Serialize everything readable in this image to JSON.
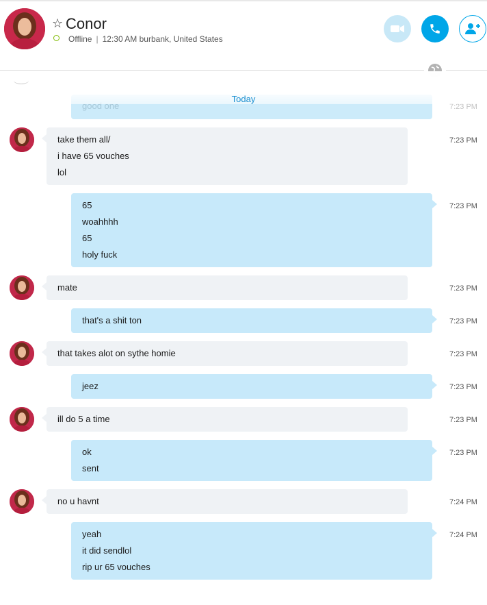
{
  "contact": {
    "name": "Conor",
    "status": "Offline",
    "local_info": "12:30 AM burbank, United States"
  },
  "header_buttons": {
    "video_icon": "video-camera-icon",
    "call_icon": "phone-icon",
    "add_icon": "add-people-icon"
  },
  "colors": {
    "accent": "#00a6e8",
    "outgoing_bubble": "#c7e9fa",
    "incoming_bubble": "#eff2f5",
    "date_label": "#1b8fd0",
    "offline_ring": "#7fba00"
  },
  "date_separator": "Today",
  "previous_message": {
    "text": "good one",
    "time": "7:23 PM"
  },
  "messages": [
    {
      "dir": "in",
      "lines": [
        "take them all/",
        "i have 65 vouches",
        "lol"
      ],
      "time": "7:23 PM"
    },
    {
      "dir": "out",
      "lines": [
        "65",
        "woahhhh",
        "65",
        "holy fuck"
      ],
      "time": "7:23 PM"
    },
    {
      "dir": "in",
      "lines": [
        "mate"
      ],
      "time": "7:23 PM"
    },
    {
      "dir": "out",
      "lines": [
        "that's a shit ton"
      ],
      "time": "7:23 PM"
    },
    {
      "dir": "in",
      "lines": [
        "that takes alot on sythe homie"
      ],
      "time": "7:23 PM"
    },
    {
      "dir": "out",
      "lines": [
        "jeez"
      ],
      "time": "7:23 PM"
    },
    {
      "dir": "in",
      "lines": [
        "ill do 5 a time"
      ],
      "time": "7:23 PM"
    },
    {
      "dir": "out",
      "lines": [
        "ok",
        "sent"
      ],
      "time": "7:23 PM"
    },
    {
      "dir": "in",
      "lines": [
        "no u havnt"
      ],
      "time": "7:24 PM"
    },
    {
      "dir": "out",
      "lines": [
        "yeah",
        "it did sendlol",
        "rip ur 65 vouches"
      ],
      "time": "7:24 PM"
    }
  ]
}
